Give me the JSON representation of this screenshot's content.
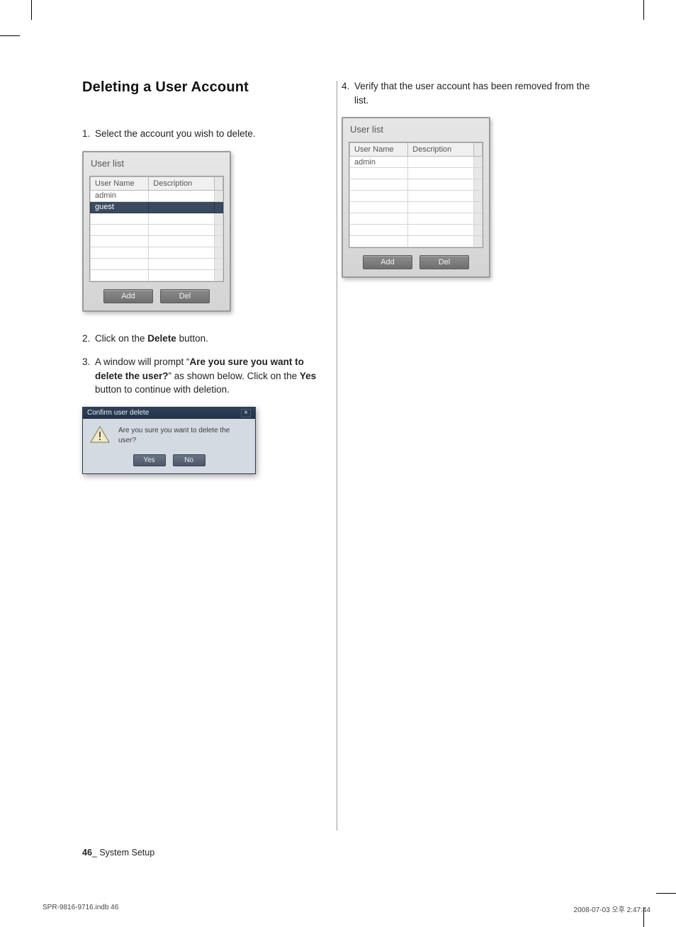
{
  "heading": "Deleting a User Account",
  "steps": {
    "s1": {
      "num": "1.",
      "text": "Select the account you wish to delete."
    },
    "s2": {
      "num": "2.",
      "pre": "Click on the ",
      "bold": "Delete",
      "post": " button."
    },
    "s3": {
      "num": "3.",
      "t1": "A window will prompt “",
      "b1": "Are you sure you want to delete the user?",
      "t2": "” as shown below. Click on the ",
      "b2": "Yes",
      "t3": " button to continue with deletion."
    },
    "s4": {
      "num": "4.",
      "text": "Verify that the user account has been removed from the list."
    }
  },
  "userlist": {
    "title": "User list",
    "headers": {
      "name": "User Name",
      "desc": "Description"
    },
    "rows_left": [
      "admin",
      "guest"
    ],
    "rows_right": [
      "admin"
    ],
    "buttons": {
      "add": "Add",
      "del": "Del"
    }
  },
  "dialog": {
    "title": "Confirm user delete",
    "message": "Are you sure you want to delete the user?",
    "yes": "Yes",
    "no": "No"
  },
  "footer": {
    "page": "46",
    "sep": "_ ",
    "section": "System Setup"
  },
  "print": {
    "file": "SPR-9816-9716.indb   46",
    "timestamp": "2008-07-03   오후 2:47:44"
  }
}
